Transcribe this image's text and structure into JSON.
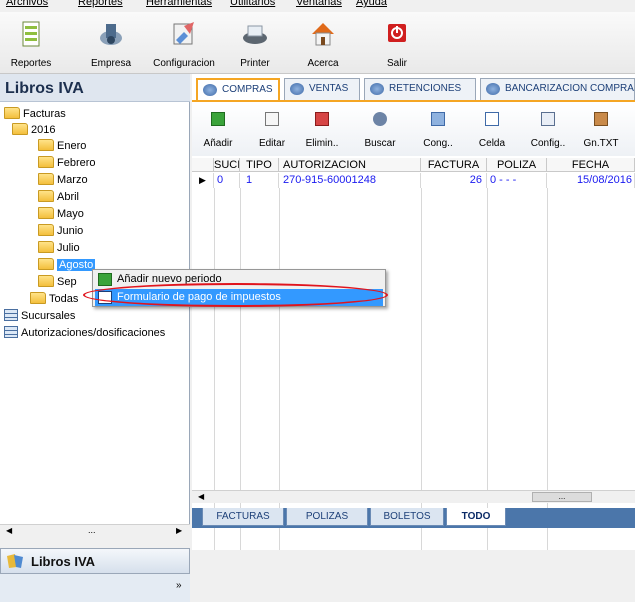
{
  "menu": [
    "Archivos",
    "Reportes",
    "Herramientas",
    "Utilitarios",
    "Ventanas",
    "Ayuda"
  ],
  "toolbar": [
    "Reportes",
    "Empresa",
    "Configuracion",
    "Printer",
    "Acerca",
    "Salir"
  ],
  "left_panel": {
    "title": "Libros IVA",
    "tree": {
      "root": "Facturas",
      "year": "2016",
      "months": [
        "Enero",
        "Febrero",
        "Marzo",
        "Abril",
        "Mayo",
        "Junio",
        "Julio",
        "Agosto",
        "Sep"
      ],
      "selected": "Agosto",
      "todas": "Todas",
      "sucursales": "Sucursales",
      "autorizaciones": "Autorizaciones/dosificaciones"
    },
    "scroll_mark": "...",
    "footer": "Libros IVA",
    "chevron": "»"
  },
  "tabs": [
    "COMPRAS",
    "VENTAS",
    "RETENCIONES",
    "BANCARIZACION COMPRAS"
  ],
  "subtoolbar": [
    "Añadir",
    "Editar",
    "Elimin..",
    "Buscar",
    "Cong..",
    "Celda",
    "Config..",
    "Gn.TXT"
  ],
  "table": {
    "headers": [
      "SUCI",
      "TIPO",
      "AUTORIZACION",
      "FACTURA",
      "POLIZA",
      "FECHA"
    ],
    "rows": [
      {
        "suc": "0",
        "tipo": "1",
        "autorizacion": "270-915-60001248",
        "factura": "26",
        "poliza": "0  -  - -",
        "fecha": "15/08/2016"
      }
    ]
  },
  "bottom_tabs": [
    "FACTURAS",
    "POLIZAS",
    "BOLETOS",
    "TODO"
  ],
  "context_menu": [
    "Añadir nuevo periodo",
    "Formulario de pago de impuestos"
  ],
  "colors": {
    "highlight": "#3399ff",
    "accent_tab": "#f5a623",
    "annotation": "#e0141d",
    "row_text": "#1a1af0"
  }
}
